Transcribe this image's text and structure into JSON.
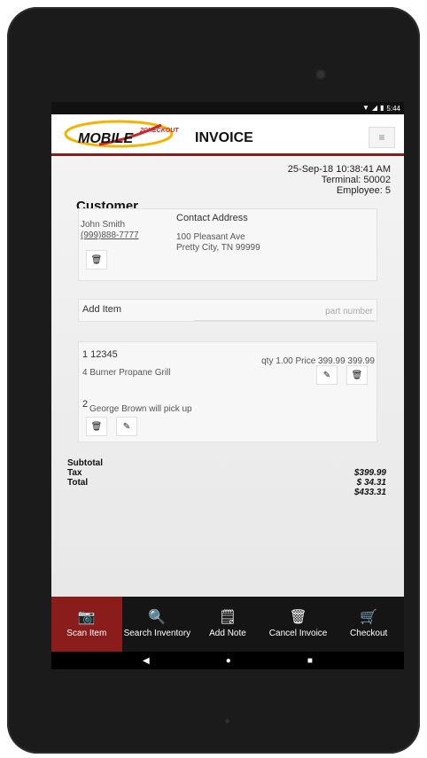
{
  "status_bar": {
    "time": "5:44"
  },
  "app": {
    "logo_main": "MOBILE",
    "logo_sup": "2CHECKOUT",
    "title": "INVOICE",
    "menu_icon": "hamburger-icon"
  },
  "meta": {
    "datetime": "25-Sep-18 10:38:41 AM",
    "terminal": "Terminal: 50002",
    "employee": "Employee: 5"
  },
  "customer": {
    "section_title": "Customer",
    "name": "John Smith",
    "phone": "(999)888-7777",
    "contact_label": "Contact Address",
    "address_line1": "100 Pleasant Ave",
    "address_line2": "Pretty City, TN 99999"
  },
  "add_item": {
    "label": "Add Item",
    "placeholder": "part number"
  },
  "items": [
    {
      "number": "1 12345",
      "description": "4 Burner Propane Grill",
      "price_line": "qty 1.00 Price 399.99 399.99"
    }
  ],
  "notes": [
    {
      "number": "2",
      "text": "George Brown will pick up"
    }
  ],
  "totals": {
    "labels": [
      "Subtotal",
      "Tax",
      "Total"
    ],
    "values": [
      "$399.99",
      "$ 34.31",
      "$433.31"
    ]
  },
  "bottom_nav": [
    {
      "label": "Scan Item",
      "icon": "camera-icon",
      "active": true
    },
    {
      "label": "Search Inventory",
      "icon": "search-icon",
      "active": false
    },
    {
      "label": "Add Note",
      "icon": "note-icon",
      "active": false
    },
    {
      "label": "Cancel Invoice",
      "icon": "trash-icon",
      "active": false
    },
    {
      "label": "Checkout",
      "icon": "cart-icon",
      "active": false
    }
  ],
  "colors": {
    "accent": "#8b1c1c",
    "nav_bg": "#151515"
  }
}
